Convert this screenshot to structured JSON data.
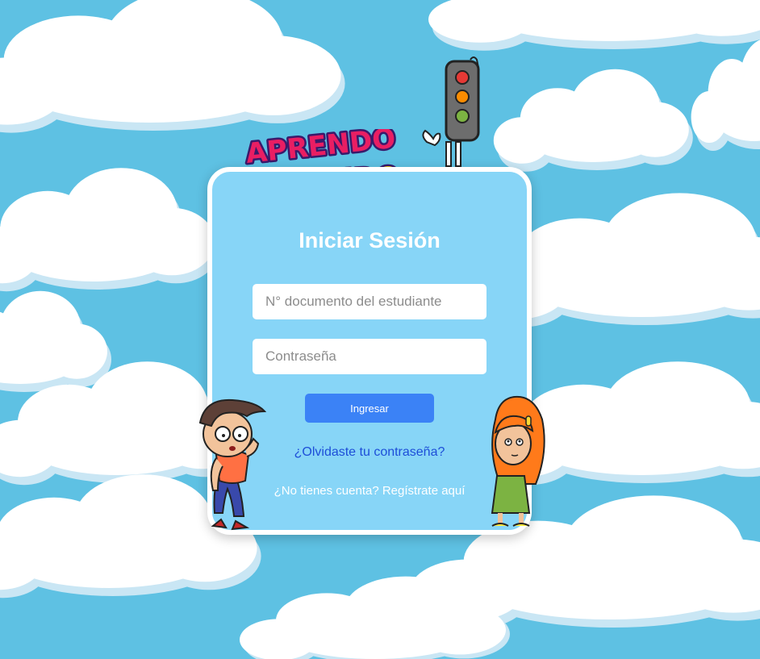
{
  "login": {
    "title": "Iniciar Sesión",
    "document_placeholder": "N° documento del estudiante",
    "password_placeholder": "Contraseña",
    "submit_label": "Ingresar",
    "forgot_link": "¿Olvidaste tu contraseña?",
    "register_link": "¿No tienes cuenta? Regístrate aquí"
  },
  "logo": {
    "line1": "APRENDO",
    "line2": "JUGANDO"
  },
  "icons": [
    "traffic-light-icon",
    "boy-character-icon",
    "girl-character-icon"
  ],
  "colors": {
    "sky": "#5ec1e3",
    "card": "#87d5f7",
    "button": "#3b82f6",
    "link": "#1d4ed8"
  }
}
